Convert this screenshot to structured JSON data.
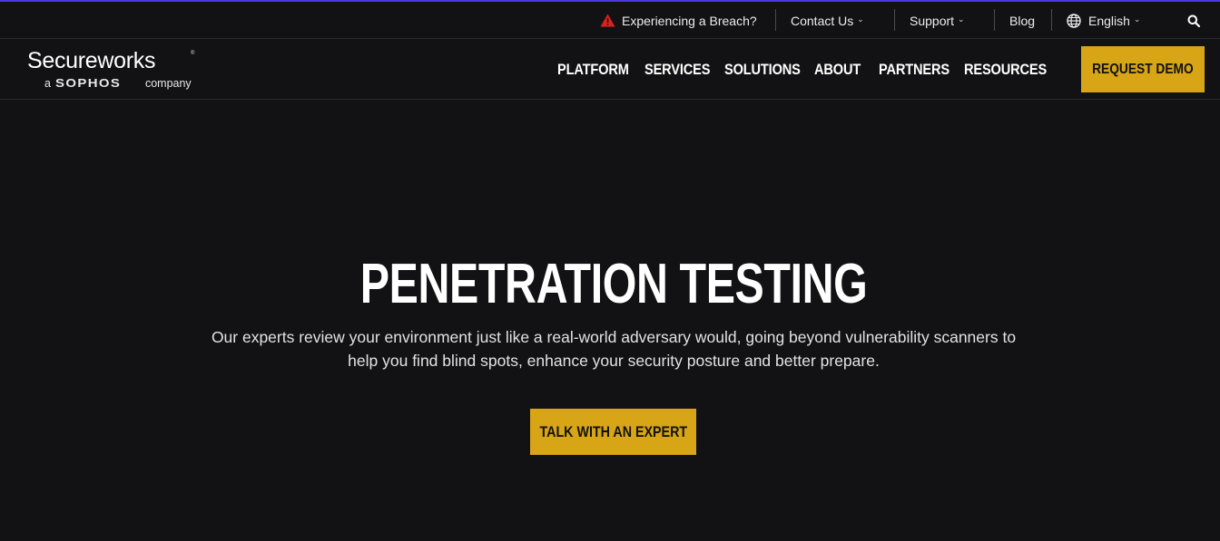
{
  "utility": {
    "breach": "Experiencing a Breach?",
    "contact": "Contact Us",
    "support": "Support",
    "blog": "Blog",
    "language": "English"
  },
  "logo": {
    "name": "Secureworks",
    "prefix": "a",
    "parent_brand": "SOPHOS",
    "suffix": "company"
  },
  "nav": {
    "items": [
      "PLATFORM",
      "SERVICES",
      "SOLUTIONS",
      "ABOUT",
      "PARTNERS",
      "RESOURCES"
    ],
    "demo_label": "REQUEST DEMO"
  },
  "hero": {
    "title": "PENETRATION TESTING",
    "description": "Our experts review your environment just like a real-world adversary would, going beyond vulnerability scanners to help you find blind spots, enhance your security posture and better prepare.",
    "cta_label": "TALK WITH AN EXPERT"
  },
  "colors": {
    "background": "#121214",
    "accent_gold": "#d8a517",
    "top_accent": "#4b3bd8",
    "warning_red": "#e02020"
  },
  "icons": [
    "warning-icon",
    "chevron-down-icon",
    "globe-icon",
    "search-icon"
  ]
}
